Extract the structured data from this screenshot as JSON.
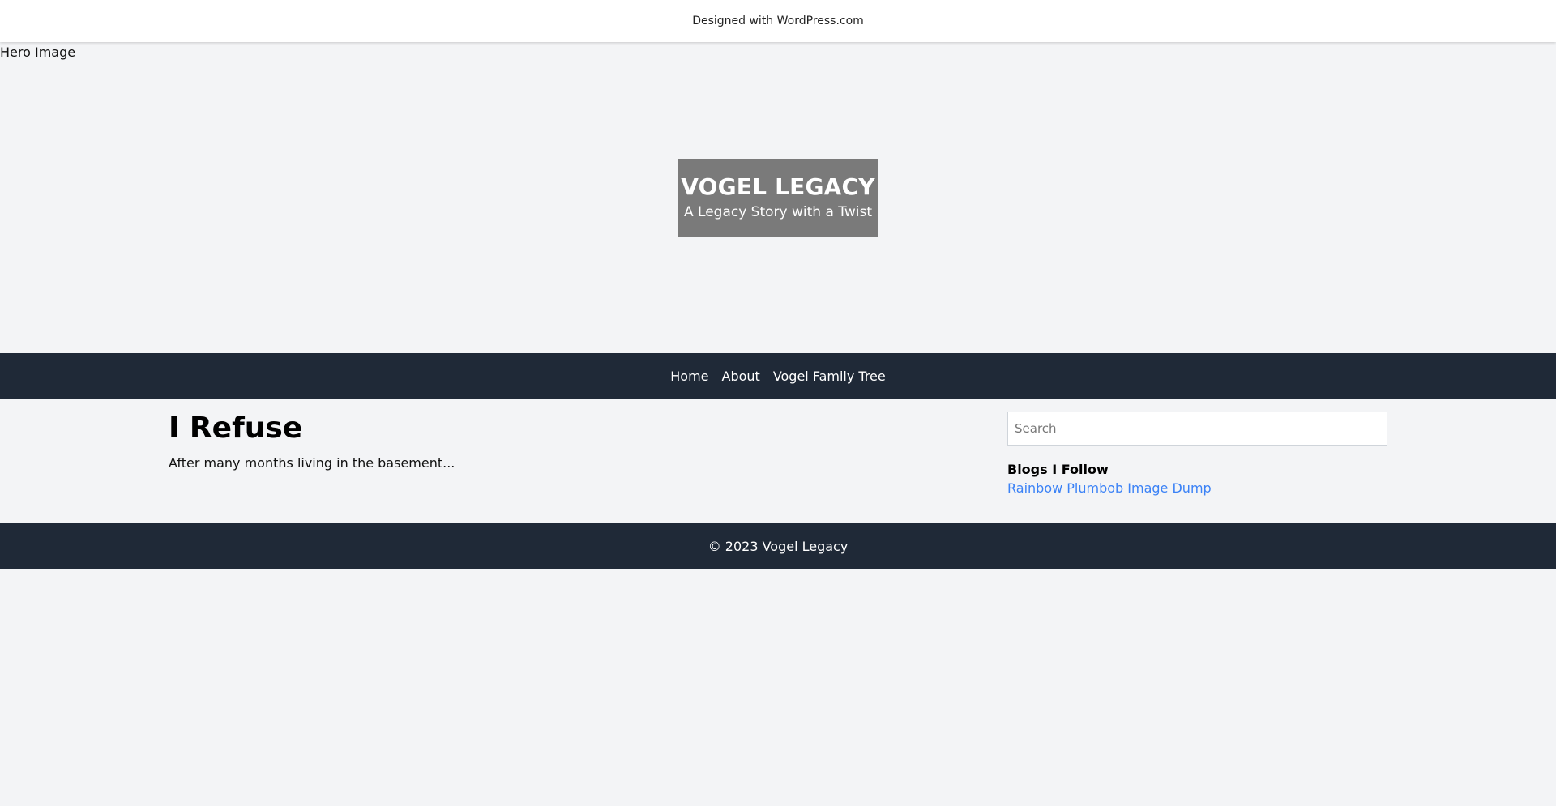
{
  "topbar": {
    "credit": "Designed with WordPress.com"
  },
  "hero": {
    "alt_text": "Hero Image",
    "site_title": "VOGEL LEGACY",
    "tagline": "A Legacy Story with a Twist",
    "title_box_color": "#7a7a7a"
  },
  "nav": {
    "items": [
      {
        "label": "Home"
      },
      {
        "label": "About"
      },
      {
        "label": "Vogel Family Tree"
      }
    ],
    "background": "#1f2937"
  },
  "post": {
    "title": "I Refuse",
    "excerpt": "After many months living in the basement..."
  },
  "sidebar": {
    "search_placeholder": "Search",
    "search_value": "",
    "widget_title": "Blogs I Follow",
    "links": [
      {
        "label": "Rainbow Plumbob Image Dump"
      }
    ],
    "link_color": "#3b82f6"
  },
  "footer": {
    "copyright": "© 2023 Vogel Legacy"
  }
}
